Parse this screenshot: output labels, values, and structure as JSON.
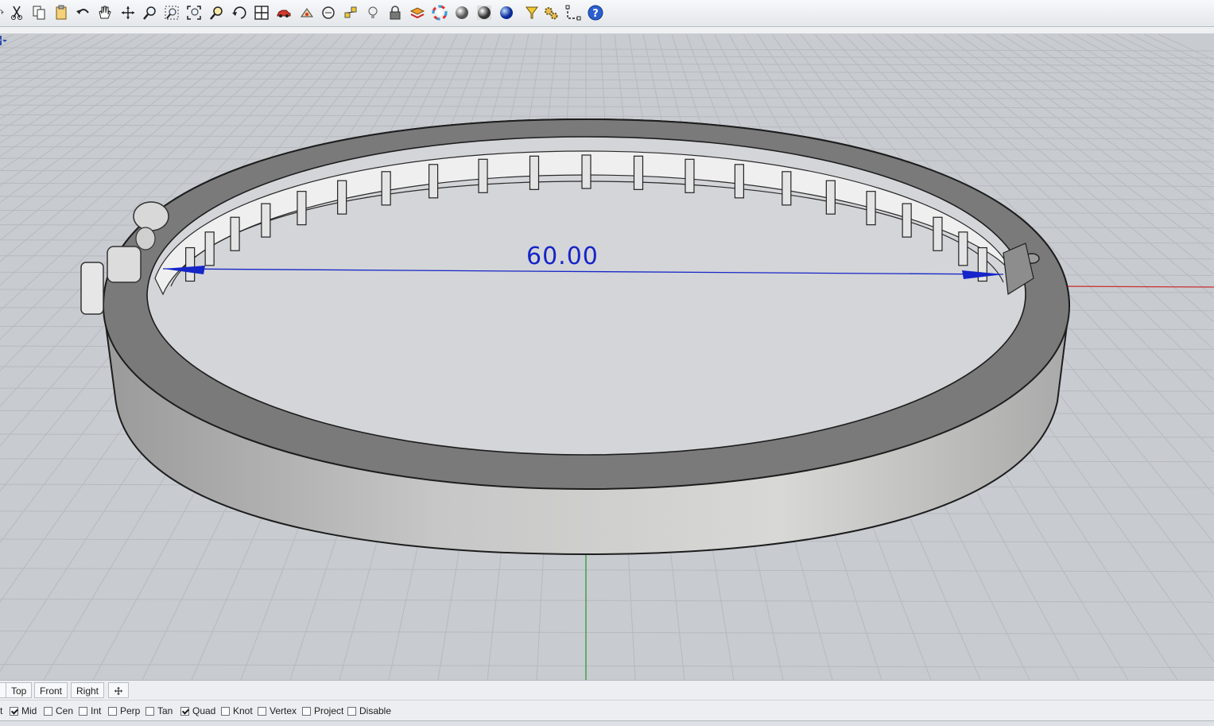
{
  "toolbar": {
    "icons": [
      "select-arrow-icon",
      "cut-icon",
      "copy-icon",
      "paste-icon",
      "undo-icon",
      "pan-hand-icon",
      "rotate-view-icon",
      "zoom-icon",
      "zoom-window-icon",
      "zoom-extents-icon",
      "zoom-selected-icon",
      "rotate-icon",
      "four-viewports-icon",
      "car-icon",
      "transform-icon",
      "circle-icon",
      "points-icon",
      "light-bulb-icon",
      "lock-icon",
      "layer-icon",
      "color-wheel-icon",
      "gray-sphere-icon",
      "shaded-sphere-icon",
      "blue-sphere-icon",
      "filter-icon",
      "gears-icon",
      "dimension-icon",
      "help-icon"
    ]
  },
  "viewport": {
    "dimension_text": "60.00",
    "colors": {
      "background": "#c8cbd0",
      "grid": "#b3b7bd",
      "x_axis": "#c83030",
      "y_axis": "#2e9a3a",
      "dimension": "#1525c8"
    }
  },
  "tabs": [
    {
      "label": "Top"
    },
    {
      "label": "Front"
    },
    {
      "label": "Right"
    }
  ],
  "snaps": [
    {
      "label": "t",
      "checkbox": false
    },
    {
      "label": "Mid",
      "checked": true
    },
    {
      "label": "Cen",
      "checked": false
    },
    {
      "label": "Int",
      "checked": false
    },
    {
      "label": "Perp",
      "checked": false
    },
    {
      "label": "Tan",
      "checked": false
    },
    {
      "label": "Quad",
      "checked": true
    },
    {
      "label": "Knot",
      "checked": false
    },
    {
      "label": "Vertex",
      "checked": false
    },
    {
      "label": "Project",
      "checked": false
    },
    {
      "label": "Disable",
      "checked": false
    }
  ]
}
